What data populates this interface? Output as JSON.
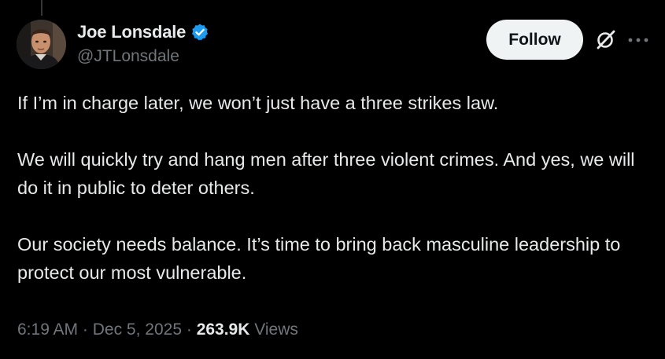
{
  "author": {
    "display_name": "Joe Lonsdale",
    "handle": "@JTLonsdale",
    "verified": true
  },
  "actions": {
    "follow_label": "Follow"
  },
  "tweet": {
    "paragraphs": [
      "If I’m in charge later, we won’t just have a three strikes law.",
      "We will quickly try and hang men after three violent crimes. And yes, we will do it in public to deter others.",
      "Our society needs balance. It’s time to bring back masculine leadership to protect our most vulnerable."
    ]
  },
  "meta": {
    "time": "6:19 AM",
    "separator": "·",
    "date": "Dec 5, 2025",
    "views_count": "263.9K",
    "views_label": "Views"
  },
  "icons": {
    "verified": "verified-badge-icon",
    "grok": "grok-icon",
    "more": "more-icon"
  },
  "colors": {
    "background": "#000000",
    "primary_text": "#e7e9ea",
    "secondary_text": "#71767b",
    "verified_blue": "#1d9bf0",
    "follow_bg": "#eff3f4"
  }
}
